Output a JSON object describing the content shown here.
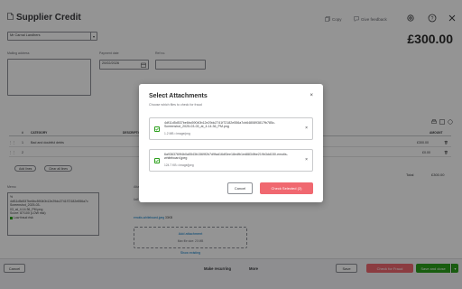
{
  "header": {
    "title": "Supplier Credit",
    "copy_label": "Copy",
    "feedback_label": "Give feedback",
    "amount": "£300.00"
  },
  "form": {
    "supplier_value": "Mr Carnal Landhers",
    "mailing_address_label": "Mailing address",
    "payment_date_label": "Payment date",
    "payment_date_value": "20/02/2026",
    "ref_no_label": "Ref no."
  },
  "table": {
    "headers": [
      "#",
      "CATEGORY",
      "DESCRIPTION",
      "AMOUNT"
    ],
    "rows": [
      {
        "num": "1",
        "category": "Bad and doubtful debts",
        "amount": "£300.00"
      },
      {
        "num": "2",
        "category": "",
        "amount": "£0.00"
      }
    ],
    "add_lines_label": "Add lines",
    "clear_lines_label": "Clear all lines",
    "total_label": "Total",
    "total_value": "£300.00"
  },
  "memo": {
    "label": "Memo",
    "lines": [
      "%",
      "4df11d5d537be6bc59040b12e29dc2741f72182e556a7c",
      "Screenshot_2025-03-",
      "03_at_4.14.36_PM.png",
      "Score: 87/100 (LOW risk)",
      "Low fraud risk"
    ]
  },
  "attachments": {
    "label": "Attachments",
    "filename": "6a9363769f4b0a5543b1569f2b7d9fad16df3.jpeg",
    "file_link": "emotis-whiteboard.jpeg",
    "file_size": "33KB",
    "add_label": "Add attachment",
    "max_size": "Max file size: 20 MB",
    "show_existing": "Show existing"
  },
  "footer": {
    "cancel_label": "Cancel",
    "make_recurring": "Make recurring",
    "more_label": "More",
    "save_label": "Save",
    "check_fraud_label": "Check for Fraud",
    "save_close_label": "Save and close"
  },
  "modal": {
    "title": "Select Attachments",
    "subtitle": "Choose which files to check for fraud",
    "files": [
      {
        "name": "4df11d5d537be6bc59040b12e29dc2741f72182e556a7cb6480893817fb785c-Screenshot_2025-03-03_at_4.14.36_PM.png",
        "meta": "1.2 MB • image/png"
      },
      {
        "name": "6a9363769f4b0a5543b1569f2b7d9fad16df3ee18edfb1ed8834fbe219b3dd150-emotis-whiteboard.jpeg",
        "meta": "124.7 KB • image/jpeg"
      }
    ],
    "cancel_label": "Cancel",
    "check_label": "Check Selected (2)"
  },
  "colors": {
    "accent_green": "#2ca01c",
    "fraud_button": "#f06870",
    "save_close": "#2ca01c"
  },
  "icons": {
    "title": "document-icon",
    "copy": "copy-icon",
    "feedback": "feedback-icon",
    "settings": "gear-icon",
    "help": "help-icon",
    "close": "close-icon"
  }
}
